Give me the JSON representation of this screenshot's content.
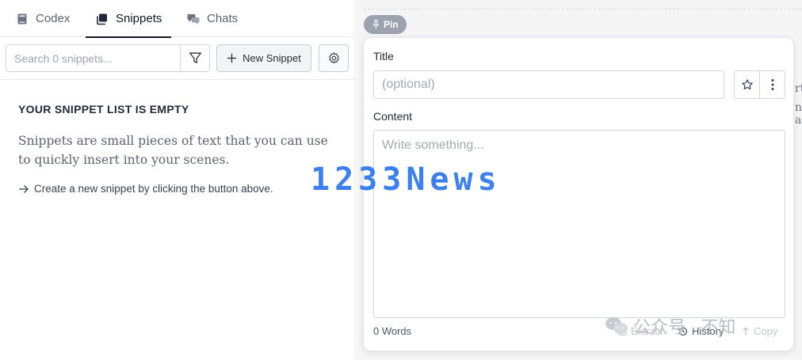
{
  "tabs": [
    {
      "label": "Codex",
      "icon": "book-icon",
      "active": false
    },
    {
      "label": "Snippets",
      "icon": "snippets-icon",
      "active": true
    },
    {
      "label": "Chats",
      "icon": "chats-icon",
      "active": false
    }
  ],
  "toolbar": {
    "search_placeholder": "Search 0 snippets...",
    "new_snippet_label": "New Snippet"
  },
  "empty_state": {
    "title": "YOUR SNIPPET LIST IS EMPTY",
    "description": "Snippets are small pieces of text that you can use to quickly insert into your scenes.",
    "hint": "Create a new snippet by clicking the button above."
  },
  "right_panel": {
    "pin_label": "Pin",
    "peek_lines": [
      "rt",
      "n a"
    ]
  },
  "editor": {
    "title_label": "Title",
    "title_placeholder": "(optional)",
    "content_label": "Content",
    "content_placeholder": "Write something...",
    "word_count": "0 Words",
    "extract_label": "Extract",
    "history_label": "History",
    "copy_label": "Copy"
  },
  "watermarks": {
    "logo_text": "1233News",
    "wechat_text": "公众号 · 不知"
  },
  "colors": {
    "accent": "#111827",
    "watermark_blue": "#3b7ff0",
    "pin_badge": "#9ca3af"
  }
}
